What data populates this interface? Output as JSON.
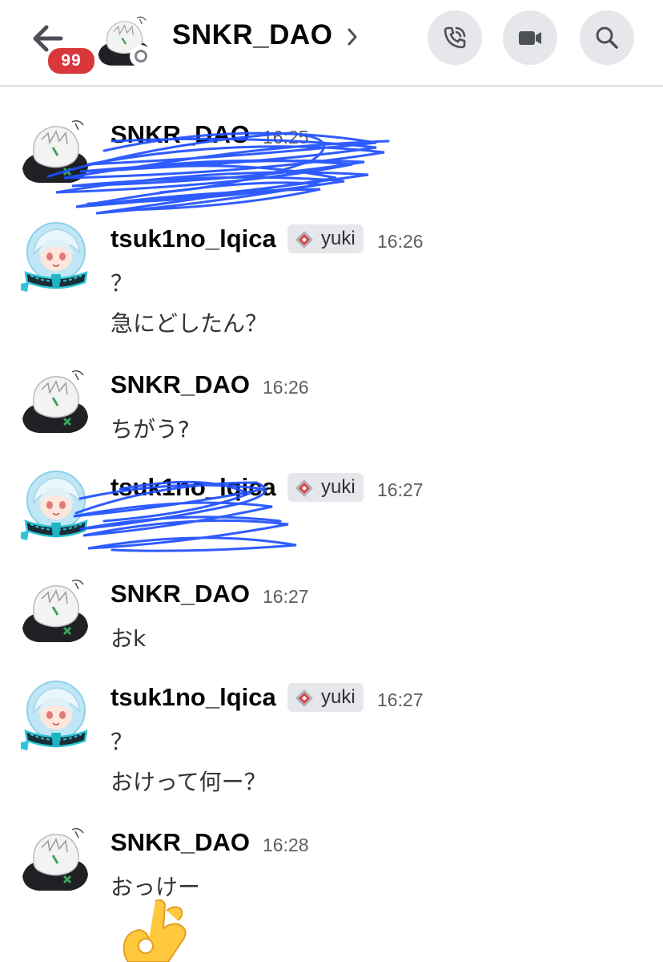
{
  "header": {
    "unread_count": "99",
    "channel_name": "SNKR_DAO"
  },
  "icons": {
    "back": "arrow-left-icon",
    "chevron": "chevron-right-icon",
    "call": "phone-call-icon",
    "video": "video-camera-icon",
    "search": "search-icon",
    "tag": "server-tag-icon",
    "reaction": "ok-hand-emoji"
  },
  "colors": {
    "badge": "#da373c",
    "scribble": "#1e4fff",
    "button_bg": "#e6e7ea",
    "timestamp": "#5c5e66"
  },
  "messages": [
    {
      "author": "SNKR_DAO",
      "time": "16:25",
      "lines": [],
      "redacted": true
    },
    {
      "author": "tsuk1no_lqica",
      "tag": "yuki",
      "time": "16:26",
      "lines": [
        "？",
        "急にどしたん？"
      ]
    },
    {
      "author": "SNKR_DAO",
      "time": "16:26",
      "lines": [
        "ちがう?"
      ]
    },
    {
      "author": "tsuk1no_lqica",
      "tag": "yuki",
      "time": "16:27",
      "lines": [],
      "redacted": true
    },
    {
      "author": "SNKR_DAO",
      "time": "16:27",
      "lines": [
        "おk"
      ]
    },
    {
      "author": "tsuk1no_lqica",
      "tag": "yuki",
      "time": "16:27",
      "lines": [
        "？",
        "おけって何ー？"
      ]
    },
    {
      "author": "SNKR_DAO",
      "time": "16:28",
      "lines": [
        "おっけー"
      ]
    }
  ]
}
